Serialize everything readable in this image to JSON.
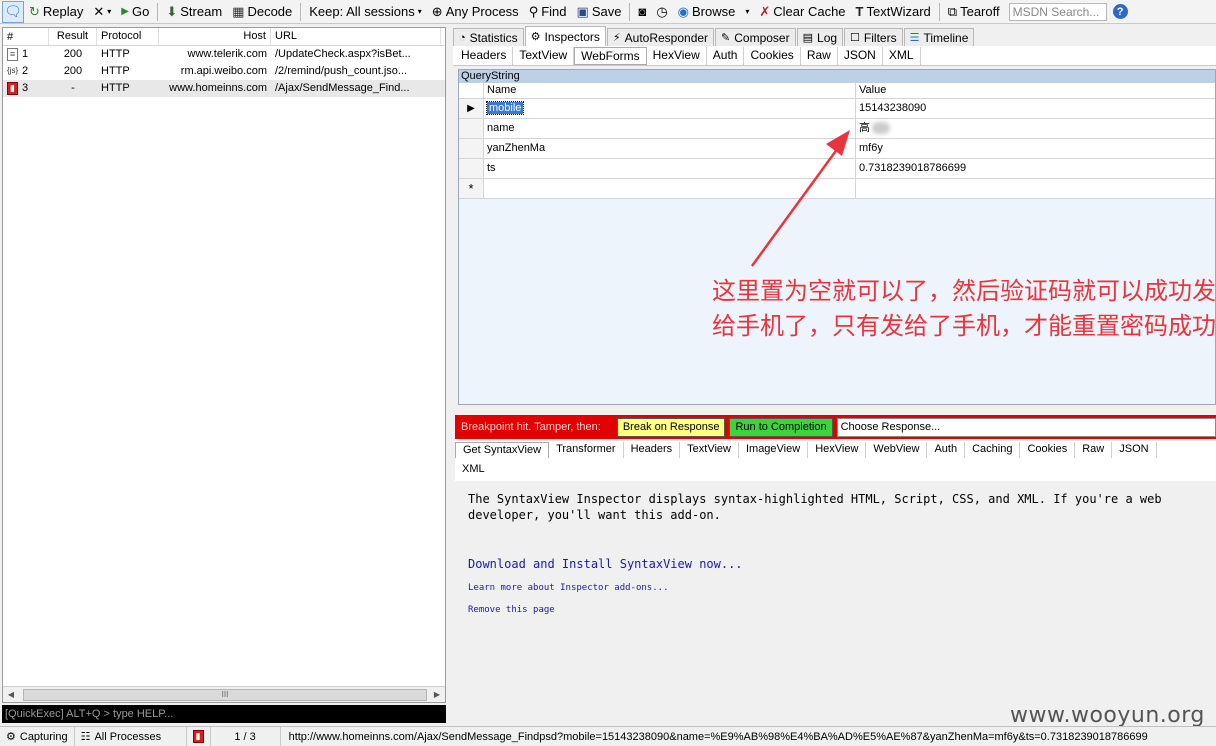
{
  "toolbar": {
    "replay": "Replay",
    "go": "Go",
    "stream": "Stream",
    "decode": "Decode",
    "keep": "Keep: All sessions",
    "any_process": "Any Process",
    "find": "Find",
    "save": "Save",
    "browse": "Browse",
    "clear_cache": "Clear Cache",
    "textwizard": "TextWizard",
    "tearoff": "Tearoff",
    "msdn_placeholder": "MSDN Search..."
  },
  "sessions": {
    "headers": [
      "#",
      "Result",
      "Protocol",
      "Host",
      "URL"
    ],
    "rows": [
      {
        "num": "1",
        "result": "200",
        "protocol": "HTTP",
        "host": "www.telerik.com",
        "url": "/UpdateCheck.aspx?isBet..."
      },
      {
        "num": "2",
        "result": "200",
        "protocol": "HTTP",
        "host": "rm.api.weibo.com",
        "url": "/2/remind/push_count.jso..."
      },
      {
        "num": "3",
        "result": "-",
        "protocol": "HTTP",
        "host": "www.homeinns.com",
        "url": "/Ajax/SendMessage_Find..."
      }
    ],
    "scroll_thumb": "III"
  },
  "quickexec": "[QuickExec] ALT+Q > type HELP...",
  "right_tabs": [
    "Statistics",
    "Inspectors",
    "AutoResponder",
    "Composer",
    "Log",
    "Filters",
    "Timeline"
  ],
  "sub_tabs": [
    "Headers",
    "TextView",
    "WebForms",
    "HexView",
    "Auth",
    "Cookies",
    "Raw",
    "JSON",
    "XML"
  ],
  "webforms": {
    "title": "QueryString",
    "col_name": "Name",
    "col_value": "Value",
    "rows": [
      {
        "name": "mobile",
        "value": "15143238090"
      },
      {
        "name": "name",
        "value": "高"
      },
      {
        "name": "yanZhenMa",
        "value": "mf6y"
      },
      {
        "name": "ts",
        "value": "0.7318239018786699"
      }
    ]
  },
  "annotation": "这里置为空就可以了，然后验证码就可以成功发给手机了，只有发给了手机，才能重置密码成功",
  "breakpoint": {
    "text": "Breakpoint hit. Tamper, then:",
    "break_btn": "Break on Response",
    "run_btn": "Run to Completion",
    "choose": "Choose Response..."
  },
  "response_tabs": [
    "Get SyntaxView",
    "Transformer",
    "Headers",
    "TextView",
    "ImageView",
    "HexView",
    "WebView",
    "Auth",
    "Caching",
    "Cookies",
    "Raw",
    "JSON"
  ],
  "response_tabs_row2": [
    "XML"
  ],
  "syntaxview": {
    "desc": "The SyntaxView Inspector displays syntax-highlighted HTML, Script, CSS, and XML. If you're a web developer, you'll want this add-on.",
    "download": "Download and Install SyntaxView now...",
    "learn": "Learn more about Inspector add-ons...",
    "remove": "Remove this page"
  },
  "statusbar": {
    "capturing": "Capturing",
    "processes": "All Processes",
    "count": "1 / 3",
    "url": "http://www.homeinns.com/Ajax/SendMessage_Findpsd?mobile=15143238090&name=%E9%AB%98%E4%BA%AD%E5%AE%87&yanZhenMa=mf6y&ts=0.7318239018786699"
  },
  "watermark": "www.wooyun.org"
}
